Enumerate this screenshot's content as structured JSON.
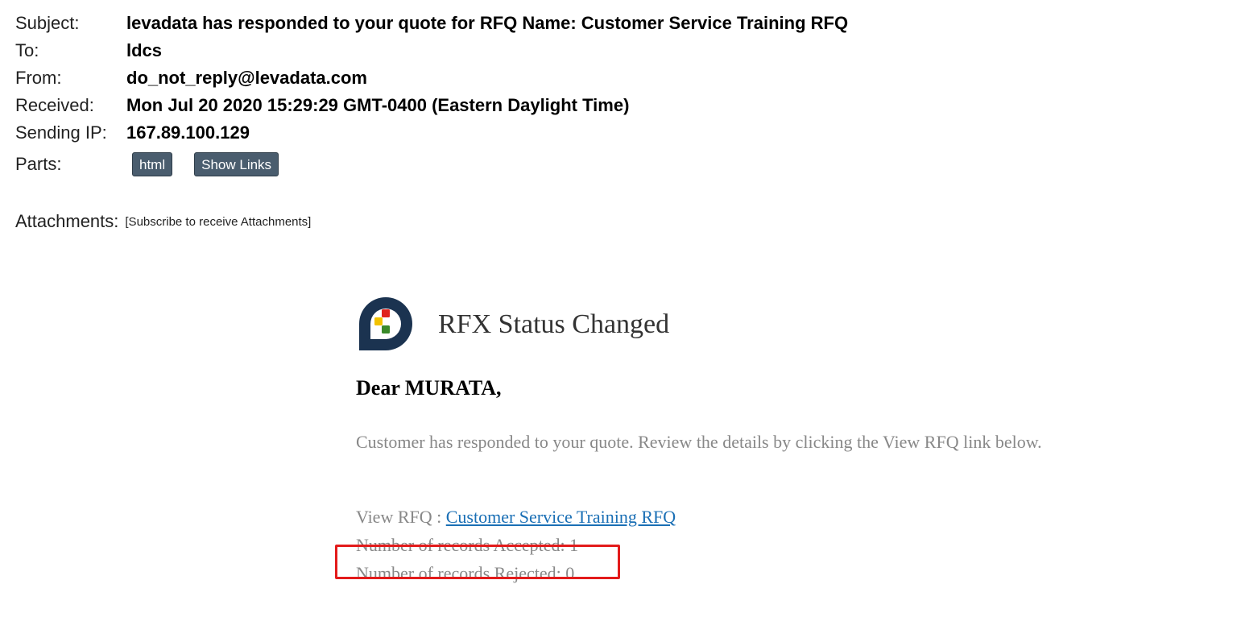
{
  "header": {
    "subject": {
      "label": "Subject:",
      "value": "levadata has responded to your quote for RFQ Name: Customer Service Training RFQ"
    },
    "to": {
      "label": "To:",
      "value": "ldcs"
    },
    "from": {
      "label": "From:",
      "value": "do_not_reply@levadata.com"
    },
    "received": {
      "label": "Received:",
      "value": "Mon Jul 20 2020 15:29:29 GMT-0400 (Eastern Daylight Time)"
    },
    "sending_ip": {
      "label": "Sending IP:",
      "value": "167.89.100.129"
    },
    "parts": {
      "label": "Parts:",
      "html_button": "html",
      "links_button": "Show Links"
    }
  },
  "attachments": {
    "label": "Attachments:",
    "value": "[Subscribe to receive Attachments]"
  },
  "email": {
    "title": "RFX Status Changed",
    "greeting": "Dear MURATA,",
    "message": "Customer has responded to your quote. Review the details by clicking the View RFQ link below.",
    "view_rfq_label": "View RFQ : ",
    "view_rfq_link": "Customer Service Training RFQ",
    "accepted": "Number of records Accepted: 1",
    "rejected": "Number of records Rejected: 0"
  },
  "colors": {
    "button_bg": "#4a5d6e",
    "link": "#1a6fb5",
    "highlight": "#e31b1b",
    "logo_navy": "#1b3350",
    "logo_red": "#e0231b",
    "logo_yellow": "#f2c200",
    "logo_green": "#3a8a2a"
  }
}
